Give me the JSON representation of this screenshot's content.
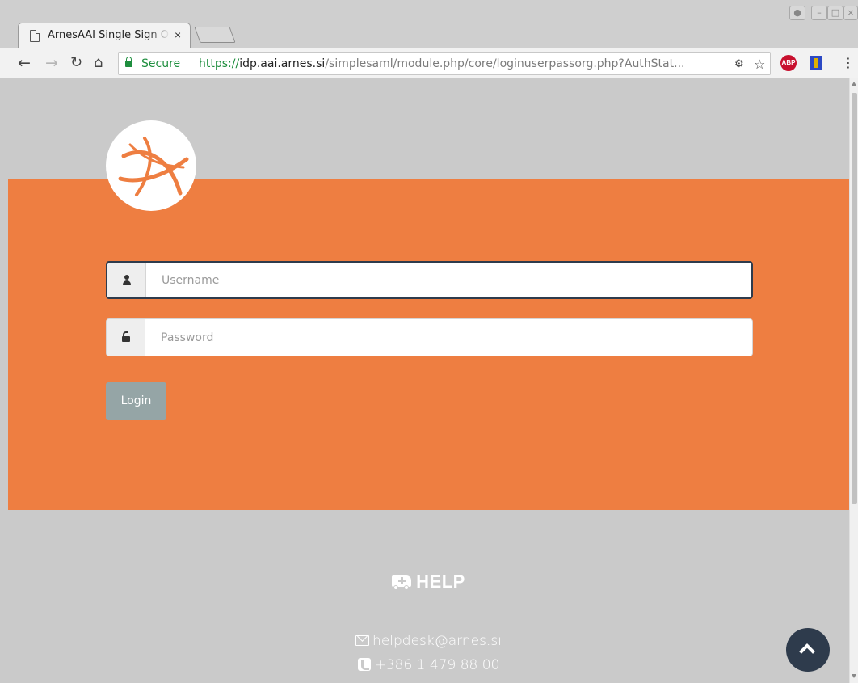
{
  "browser": {
    "tab_title": "ArnesAAI Single Sign On",
    "tab_close": "×",
    "window_buttons": [
      "minimize",
      "maximize",
      "close"
    ],
    "secure_label": "Secure",
    "url_scheme": "https://",
    "url_host": "idp.aai.arnes.si",
    "url_path": "/simplesaml/module.php/core/loginuserpassorg.php?AuthStat...",
    "extensions": [
      "adblock-plus-icon",
      "extension-icon"
    ]
  },
  "login": {
    "logo": "arnes-logo",
    "username_placeholder": "Username",
    "password_placeholder": "Password",
    "login_label": "Login"
  },
  "help": {
    "title": "HELP",
    "email": "helpdesk@arnes.si",
    "phone": "+386 1 479 88 00"
  },
  "colors": {
    "accent_orange": "#ee7e41",
    "page_gray": "#cacaca",
    "dark_navy": "#2e3b4c",
    "button_gray": "#95a5a6",
    "secure_green": "#1e8e3e"
  }
}
